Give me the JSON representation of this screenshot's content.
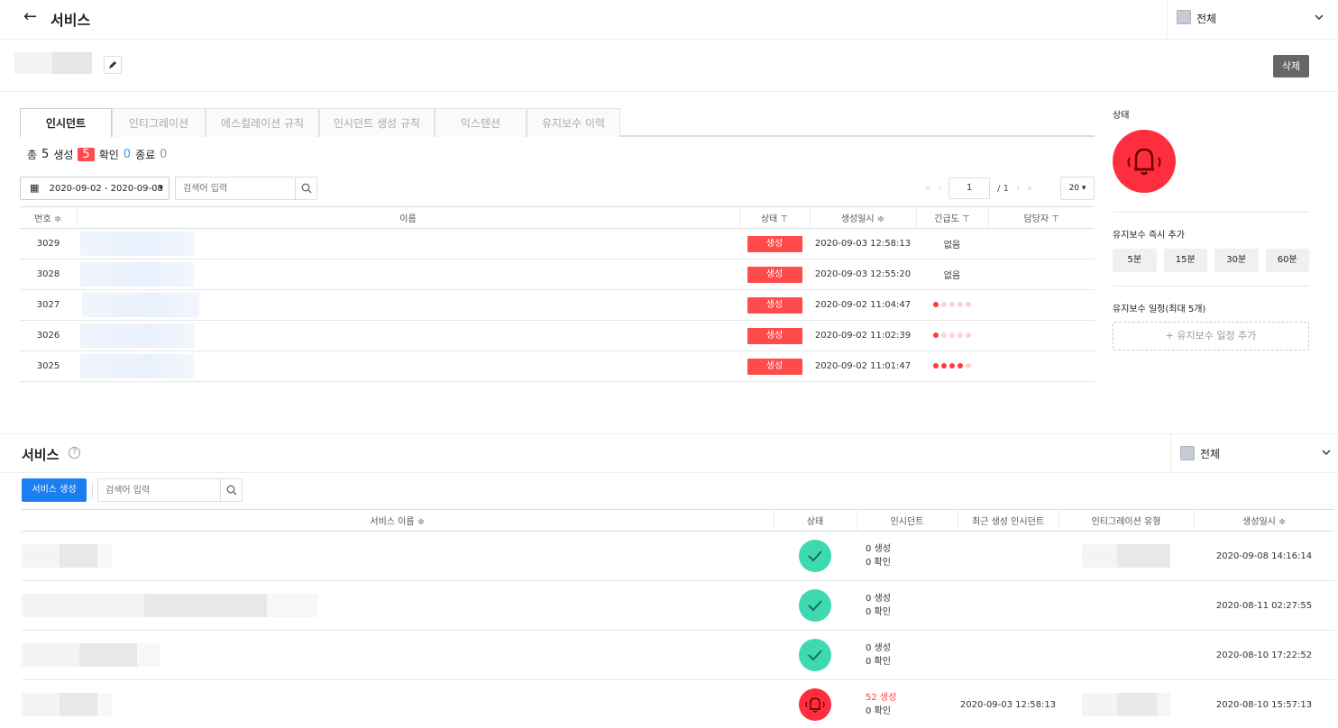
{
  "header": {
    "back_icon": "arrow-left-icon",
    "title": "서비스",
    "project_label": "전체"
  },
  "service_name_placeholder_blur": "",
  "actions": {
    "delete_label": "삭제"
  },
  "tabs": [
    {
      "label": "인시던트",
      "active": true
    },
    {
      "label": "인티그레이션",
      "active": false
    },
    {
      "label": "에스컬레이션 규칙",
      "active": false
    },
    {
      "label": "인시던트 생성 규칙",
      "active": false
    },
    {
      "label": "익스텐션",
      "active": false
    },
    {
      "label": "유지보수 이력",
      "active": false
    }
  ],
  "stats": {
    "total_label": "총",
    "total": "5",
    "created_label": "생성",
    "created": "5",
    "ack_label": "확인",
    "ack": "0",
    "resolved_label": "종료",
    "resolved": "0"
  },
  "filters": {
    "date_range": "2020-09-02 - 2020-09-08",
    "search_placeholder": "검색어 입력",
    "page_current": "1",
    "page_total": "/ 1",
    "per_page": "20"
  },
  "incident_table": {
    "headers": [
      "번호 ≑",
      "이름",
      "상태 ⊤",
      "생성일시 ≑",
      "긴급도 ⊤",
      "담당자 ⊤"
    ],
    "rows": [
      {
        "no": "3029",
        "status": "생성",
        "created_at": "2020-09-03 12:58:13",
        "urgency_text": "없음",
        "urgency_level": 0
      },
      {
        "no": "3028",
        "status": "생성",
        "created_at": "2020-09-03 12:55:20",
        "urgency_text": "없음",
        "urgency_level": 0
      },
      {
        "no": "3027",
        "status": "생성",
        "created_at": "2020-09-02 11:04:47",
        "urgency_text": "",
        "urgency_level": 1
      },
      {
        "no": "3026",
        "status": "생성",
        "created_at": "2020-09-02 11:02:39",
        "urgency_text": "",
        "urgency_level": 1
      },
      {
        "no": "3025",
        "status": "생성",
        "created_at": "2020-09-02 11:01:47",
        "urgency_text": "",
        "urgency_level": 4
      }
    ]
  },
  "right_panel": {
    "status_label": "상태",
    "status_color": "#ff2e3e",
    "quick_maint_label": "유지보수 즉시 추가",
    "quick_buttons": [
      "5분",
      "15분",
      "30분",
      "60분"
    ],
    "schedule_label": "유지보수 일정(최대 5개)",
    "add_schedule_label": "+ 유지보수 일정 추가"
  },
  "services": {
    "title": "서비스",
    "help_icon": "?",
    "project_label": "전체",
    "create_label": "서비스 생성",
    "search_placeholder": "검색어 입력",
    "headers": [
      "서비스 이름 ≑",
      "상태",
      "인시던트",
      "최근 생성 인시던트",
      "인티그레이션 유형",
      "생성일시 ≑"
    ],
    "rows": [
      {
        "status": "ok",
        "created": "0 생성",
        "ack": "0 확인",
        "recent": "",
        "created_at": "2020-09-08 14:16:14"
      },
      {
        "status": "ok",
        "created": "0 생성",
        "ack": "0 확인",
        "recent": "",
        "created_at": "2020-08-11 02:27:55"
      },
      {
        "status": "ok",
        "created": "0 생성",
        "ack": "0 확인",
        "recent": "",
        "created_at": "2020-08-10 17:22:52"
      },
      {
        "status": "alert",
        "created": "52 생성",
        "ack": "0 확인",
        "recent": "2020-09-03 12:58:13",
        "created_at": "2020-08-10 15:57:13"
      }
    ]
  }
}
